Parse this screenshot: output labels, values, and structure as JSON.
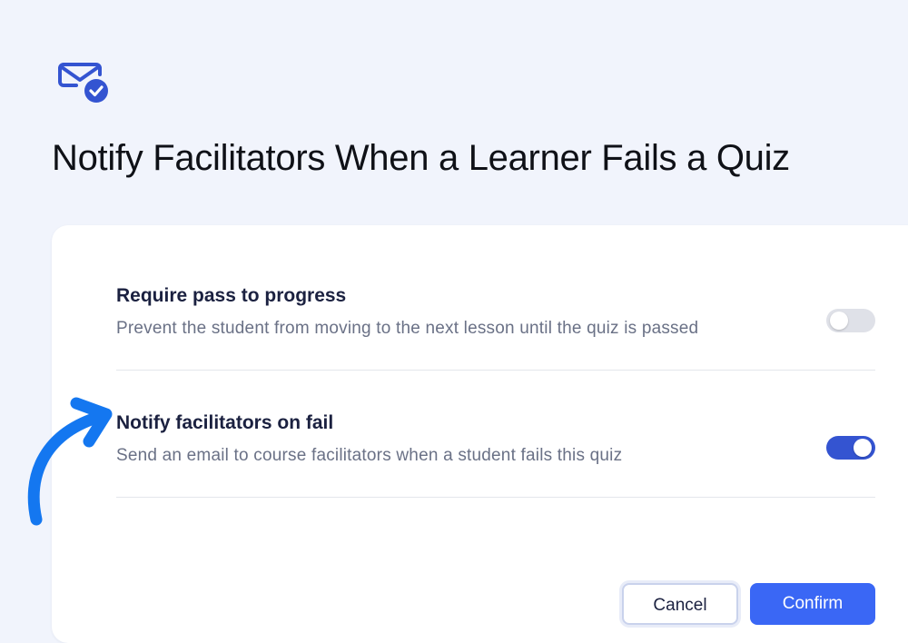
{
  "header": {
    "icon": "mail-check-icon",
    "title": "Notify Facilitators When a Learner Fails a Quiz"
  },
  "settings": [
    {
      "title": "Require pass to progress",
      "description": "Prevent the student from moving to the next lesson until the quiz is passed",
      "enabled": false
    },
    {
      "title": "Notify facilitators on fail",
      "description": "Send an email to course facilitators when a student fails this quiz",
      "enabled": true
    }
  ],
  "footer": {
    "cancel_label": "Cancel",
    "confirm_label": "Confirm"
  },
  "annotation": {
    "icon": "curved-arrow-icon"
  },
  "colors": {
    "accent": "#3454d1",
    "primary_button": "#3a67f5",
    "annotation_arrow": "#1477f0",
    "background": "#f1f4fc"
  }
}
